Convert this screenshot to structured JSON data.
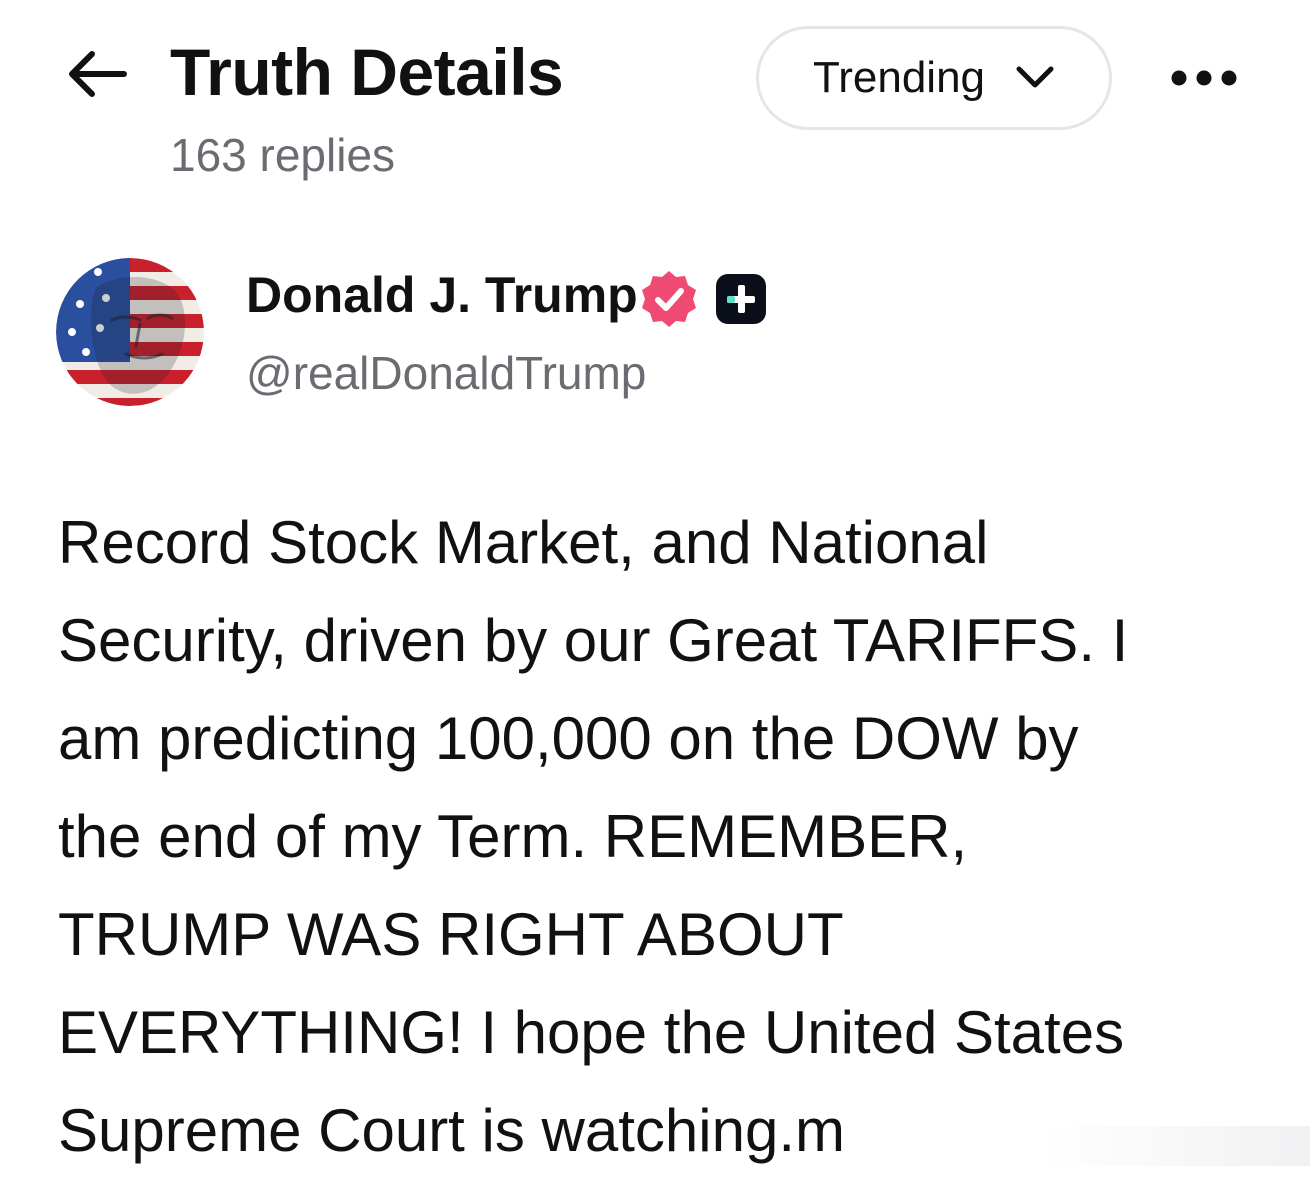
{
  "header": {
    "title": "Truth Details",
    "subtitle": "163 replies",
    "sort_selector": {
      "selected": "Trending"
    },
    "icons": {
      "back": "arrow-left-icon",
      "sort_chevron": "chevron-down-icon",
      "more": "more-horizontal-icon"
    }
  },
  "author": {
    "display_name": "Donald J. Trump",
    "handle": "@realDonaldTrump",
    "verified_badge_color": "#ef4a72",
    "plus_badge_color": "#0b0f1a",
    "plus_badge_accent": "#5ce0c8"
  },
  "post": {
    "text": "Record Stock Market, and National\nSecurity, driven by our Great TARIFFS. I\nam predicting 100,000 on the DOW by\nthe end of my Term. REMEMBER,\nTRUMP WAS RIGHT ABOUT\nEVERYTHING! I hope the United States\nSupreme Court is watching.m"
  }
}
